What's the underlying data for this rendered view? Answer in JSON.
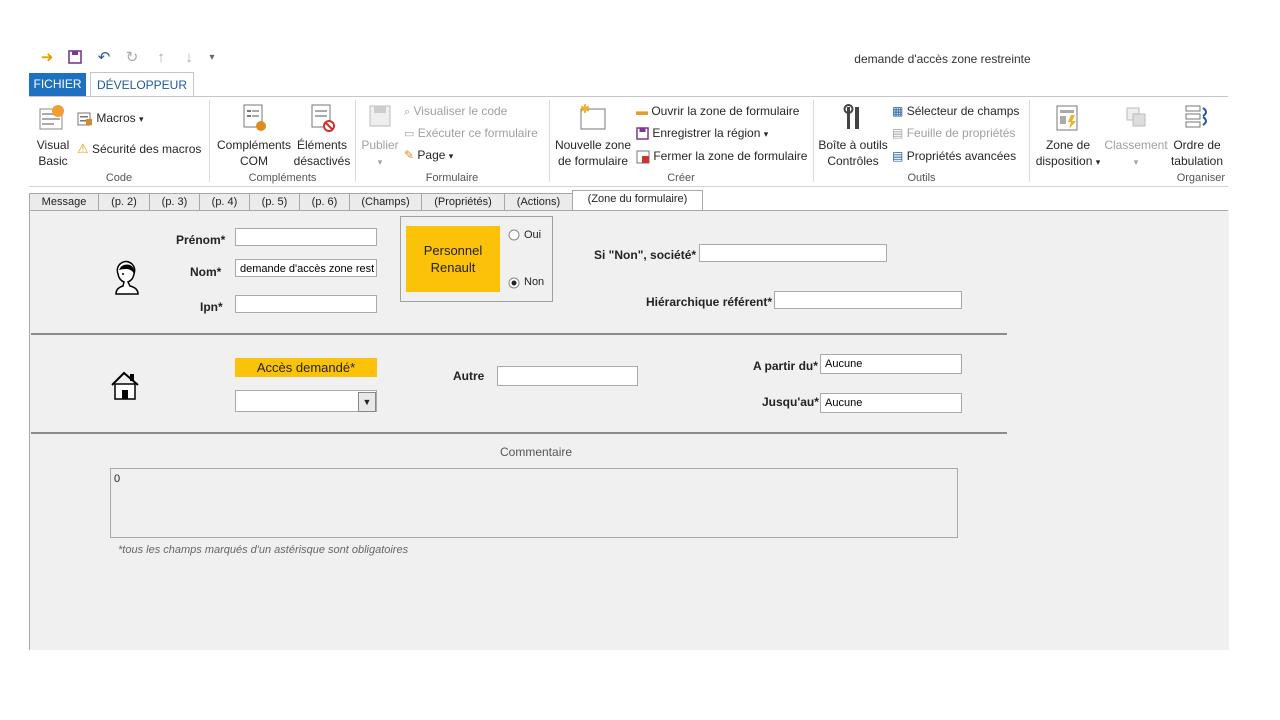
{
  "window": {
    "title": "demande d'accès zone restreinte"
  },
  "qat": {
    "icons": [
      "send-icon",
      "save-icon",
      "undo-icon",
      "redo-icon",
      "up-icon",
      "down-icon",
      "customize-icon"
    ]
  },
  "ribbon": {
    "tabs": {
      "file": "FICHIER",
      "developer": "DÉVELOPPEUR"
    },
    "code": {
      "group": "Code",
      "visual_basic": [
        "Visual",
        "Basic"
      ],
      "macros": "Macros",
      "macro_security": "Sécurité des macros"
    },
    "addins": {
      "group": "Compléments",
      "com_addins": [
        "Compléments",
        "COM"
      ],
      "disabled_items": [
        "Éléments",
        "désactivés"
      ]
    },
    "form": {
      "group": "Formulaire",
      "publish": "Publier",
      "view_code": "Visualiser le code",
      "run_form": "Exécuter ce formulaire",
      "page": "Page"
    },
    "create": {
      "group": "Créer",
      "new_region": [
        "Nouvelle zone",
        "de formulaire"
      ],
      "open_region": "Ouvrir la zone de formulaire",
      "save_region": "Enregistrer la région",
      "close_region": "Fermer la zone de formulaire"
    },
    "tools": {
      "group": "Outils",
      "toolbox": [
        "Boîte à outils",
        "Contrôles"
      ],
      "field_chooser": "Sélecteur de champs",
      "property_sheet": "Feuille de propriétés",
      "advanced_properties": "Propriétés avancées"
    },
    "arrange": {
      "group": "Organiser",
      "layout": [
        "Zone de",
        "disposition"
      ],
      "ordering": "Classement",
      "tab_order": [
        "Ordre de",
        "tabulation"
      ]
    }
  },
  "form_tabs": [
    "Message",
    "(p. 2)",
    "(p. 3)",
    "(p. 4)",
    "(p. 5)",
    "(p. 6)",
    "(Champs)",
    "(Propriétés)",
    "(Actions)",
    "(Zone du formulaire)"
  ],
  "form": {
    "prenom_label": "Prénom*",
    "prenom_value": "",
    "nom_label": "Nom*",
    "nom_value": "demande d'accès zone rest",
    "ipn_label": "Ipn*",
    "ipn_value": "",
    "personnel_renault": [
      "Personnel",
      "Renault"
    ],
    "oui": "Oui",
    "non": "Non",
    "selected_option": "Non",
    "societe_label": "Si \"Non\", société*",
    "hierarchique_label": "Hiérarchique référent*",
    "acces_label": "Accès demandé*",
    "acces_value": "",
    "autre_label": "Autre",
    "a_partir_label": "A partir du*",
    "a_partir_value": "Aucune",
    "jusqu_label": "Jusqu'au*",
    "jusqu_value": "Aucune",
    "commentaire_label": "Commentaire",
    "commentaire_value": "0",
    "note": "*tous les champs marqués d'un astérisque sont obligatoires"
  },
  "colors": {
    "accent": "#1e70c1",
    "highlight": "#fcc20a",
    "form_bg": "#f0f0f0"
  }
}
